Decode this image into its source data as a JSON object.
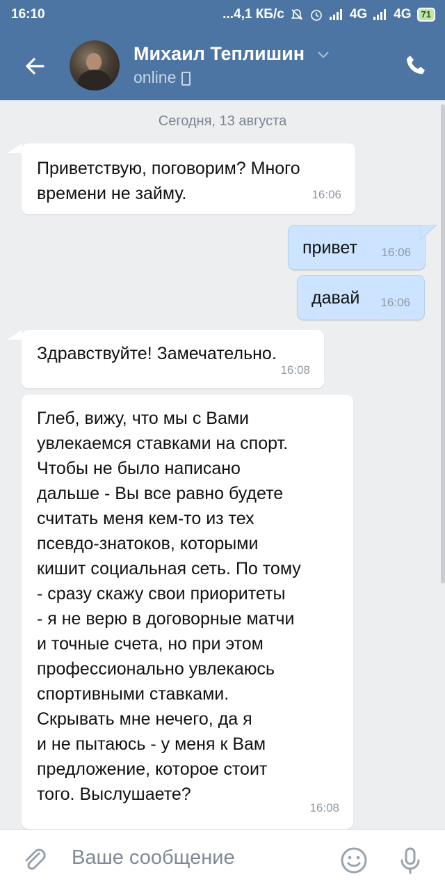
{
  "status_bar": {
    "time": "16:10",
    "speed": "...4,1 КБ/с",
    "network_1": "4G",
    "network_2": "4G",
    "battery": "71"
  },
  "header": {
    "contact_name": "Михаил Теплишин",
    "presence": "online"
  },
  "chat": {
    "date_separator": "Сегодня, 13 августа",
    "messages": [
      {
        "direction": "in",
        "text": "Приветствую, поговорим? Много\nвремени не займу.",
        "time": "16:06"
      },
      {
        "direction": "out",
        "text": "привет",
        "time": "16:06"
      },
      {
        "direction": "out",
        "text": "давай",
        "time": "16:06"
      },
      {
        "direction": "in",
        "text": "Здравствуйте! Замечательно.",
        "time": "16:08"
      },
      {
        "direction": "in",
        "text": "Глеб, вижу, что мы с Вами\nувлекаемся ставками на спорт.\nЧтобы не было написано\nдальше - Вы все равно будете\nсчитать меня кем-то из тех\nпсевдо-знатоков, которыми\nкишит социальная сеть. По тому\n- сразу скажу свои приоритеты\n- я не верю в договорные матчи\nи точные счета, но при этом\nпрофессионально увлекаюсь\nспортивными ставками.\nСкрывать мне нечего, да я\nи не пытаюсь - у меня к Вам\nпредложение, которое стоит\nтого. Выслушаете?",
        "time": "16:08"
      }
    ]
  },
  "composer": {
    "placeholder": "Ваше сообщение"
  },
  "colors": {
    "header": "#4c75a3",
    "background": "#edeef0",
    "outgoing_bubble": "#cce4ff",
    "incoming_bubble": "#ffffff"
  },
  "icons": [
    "back-arrow-icon",
    "chevron-down-icon",
    "phone-icon",
    "paperclip-icon",
    "smile-icon",
    "microphone-icon"
  ]
}
